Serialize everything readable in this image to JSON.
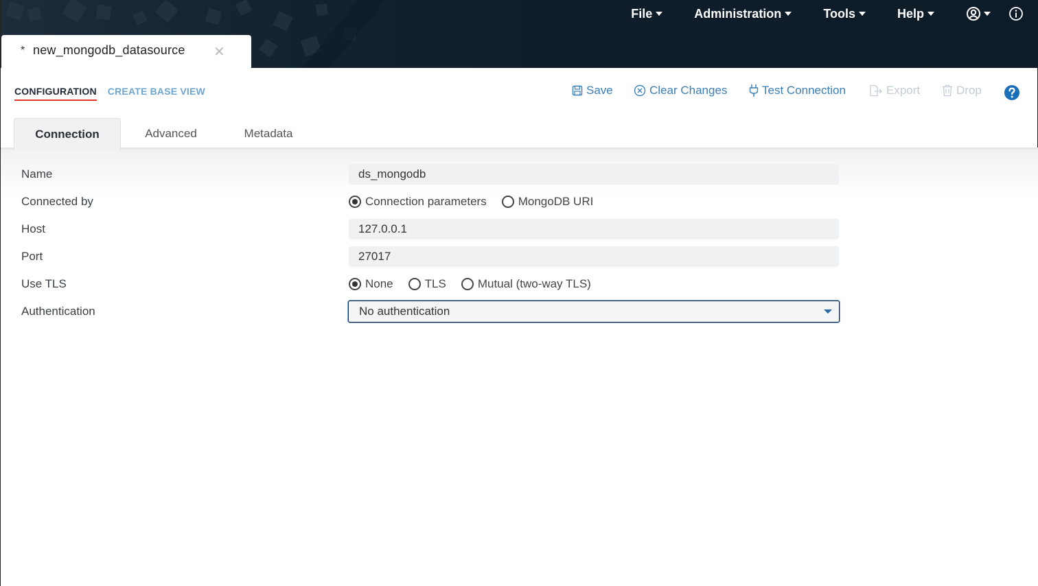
{
  "header": {
    "menu": [
      {
        "label": "File"
      },
      {
        "label": "Administration"
      },
      {
        "label": "Tools"
      },
      {
        "label": "Help"
      }
    ],
    "user_icon": "user-circle-icon",
    "info_icon": "info-circle-icon"
  },
  "document_tab": {
    "dirty_marker": "*",
    "title": "new_mongodb_datasource",
    "close_glyph": "✕"
  },
  "subnav": {
    "configuration": "CONFIGURATION",
    "create_base_view": "CREATE BASE VIEW"
  },
  "toolbar": {
    "save": "Save",
    "clear_changes": "Clear Changes",
    "test_connection": "Test Connection",
    "export": "Export",
    "drop": "Drop",
    "help_icon": "question-circle-icon"
  },
  "tabs": {
    "connection": "Connection",
    "advanced": "Advanced",
    "metadata": "Metadata"
  },
  "form": {
    "name": {
      "label": "Name",
      "value": "ds_mongodb"
    },
    "connected_by": {
      "label": "Connected by",
      "options": [
        "Connection parameters",
        "MongoDB URI"
      ],
      "selected": "Connection parameters"
    },
    "host": {
      "label": "Host",
      "value": "127.0.0.1"
    },
    "port": {
      "label": "Port",
      "value": "27017"
    },
    "use_tls": {
      "label": "Use TLS",
      "options": [
        "None",
        "TLS",
        "Mutual (two-way TLS)"
      ],
      "selected": "None"
    },
    "authentication": {
      "label": "Authentication",
      "value": "No authentication"
    }
  },
  "colors": {
    "header_bg": "#14222f",
    "accent_red": "#e1362c",
    "link_blue": "#3b7fb6",
    "disabled": "#c3ccd6"
  }
}
